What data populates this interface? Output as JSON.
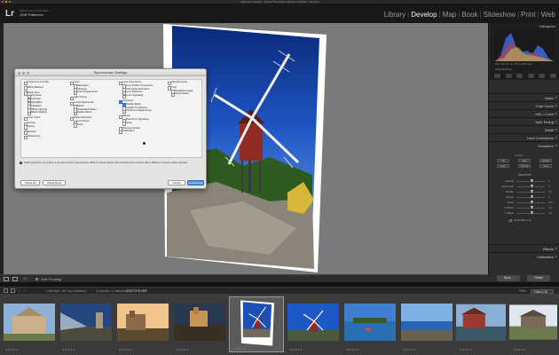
{
  "window": {
    "title": "Lightroom Catalog - Adobe Photoshop Lightroom Classic - Develop"
  },
  "identity": {
    "line1": "Setting up for connection",
    "line2": "JDW Patterson"
  },
  "logo": "Lr",
  "modules": [
    "Library",
    "Develop",
    "Map",
    "Book",
    "Slideshow",
    "Print",
    "Web"
  ],
  "active_module": "Develop",
  "histogram": {
    "label": "Histogram",
    "meta": "ISO 100   23 mm   f/8.0   1/250 sec",
    "original": "Original Photo"
  },
  "panels": {
    "basic": "Basic",
    "tone_curve": "Tone Curve",
    "hsl": "HSL / Color",
    "split_toning": "Split Toning",
    "detail": "Detail",
    "lens_corrections": "Lens Corrections",
    "transform": "Transform",
    "effects": "Effects",
    "calibration": "Calibration"
  },
  "transform_panel": {
    "upright": "Upright",
    "buttons": [
      "Off",
      "Auto",
      "Guided",
      "Level",
      "Vertical",
      "Full"
    ],
    "section": "Transform",
    "sliders": [
      {
        "name": "Vertical",
        "value": "0"
      },
      {
        "name": "Horizontal",
        "value": "0"
      },
      {
        "name": "Rotate",
        "value": "0.0"
      },
      {
        "name": "Aspect",
        "value": "0"
      },
      {
        "name": "Scale",
        "value": "100"
      },
      {
        "name": "X Offset",
        "value": "0.0"
      },
      {
        "name": "Y Offset",
        "value": "0.0"
      }
    ],
    "constrain": "Constrain Crop"
  },
  "sync_buttons": {
    "sync": "Sync...",
    "reset": "Reset"
  },
  "toolbar": {
    "label": "Y|Y",
    "soft_proofing": "Soft Proofing"
  },
  "filmstrip_info": {
    "collection": "Collection : AP Line selection",
    "count": "11 photos / 1 selected",
    "filename": "/DSC7478.NEF",
    "filter_label": "Filter :",
    "filter_value": "Filters Off"
  },
  "dialog": {
    "title": "Synchronise Settings",
    "col1": [
      {
        "label": "Treatment & Profile",
        "checked": false
      },
      {
        "label": "White Balance",
        "checked": false,
        "gap": true
      },
      {
        "label": "Basic Tone",
        "checked": false,
        "gap": true
      },
      {
        "label": "Exposure",
        "checked": false,
        "indent": 1
      },
      {
        "label": "Contrast",
        "checked": false,
        "indent": 1
      },
      {
        "label": "Highlights",
        "checked": false,
        "indent": 1
      },
      {
        "label": "Shadows",
        "checked": false,
        "indent": 1
      },
      {
        "label": "White Clipping",
        "checked": false,
        "indent": 1
      },
      {
        "label": "Black Clipping",
        "checked": false,
        "indent": 1
      },
      {
        "label": "Tone Curve",
        "checked": false,
        "gap": true
      },
      {
        "label": "Texture",
        "checked": false,
        "gap": true
      },
      {
        "label": "Clarity",
        "checked": false
      },
      {
        "label": "Dehaze",
        "checked": false,
        "gap": true
      },
      {
        "label": "Sharpening",
        "checked": false,
        "gap": true
      }
    ],
    "col2": [
      {
        "label": "Color",
        "checked": false
      },
      {
        "label": "Saturation",
        "checked": false,
        "indent": 1
      },
      {
        "label": "Vibrance",
        "checked": false,
        "indent": 1
      },
      {
        "label": "Color Adjustments",
        "checked": false,
        "indent": 1
      },
      {
        "label": "Split Toning",
        "checked": false,
        "gap": true
      },
      {
        "label": "Local Adjustments",
        "checked": false,
        "gap": true
      },
      {
        "label": "Brush",
        "checked": false,
        "indent": 1
      },
      {
        "label": "Graduated Filters",
        "checked": false,
        "indent": 1
      },
      {
        "label": "Radial Filters",
        "checked": false,
        "indent": 1
      },
      {
        "label": "Noise Reduction",
        "checked": false,
        "gap": true
      },
      {
        "label": "Luminance",
        "checked": false,
        "indent": 1
      },
      {
        "label": "Color",
        "checked": false,
        "indent": 1
      }
    ],
    "col3": [
      {
        "label": "Lens Corrections",
        "checked": false
      },
      {
        "label": "Lens Profile Corrections",
        "checked": false,
        "indent": 1
      },
      {
        "label": "Chromatic Aberration",
        "checked": false,
        "indent": 1
      },
      {
        "label": "Lens Distortion",
        "checked": false,
        "indent": 1
      },
      {
        "label": "Lens Vignetting",
        "checked": false,
        "indent": 1
      },
      {
        "label": "Transform",
        "checked": true,
        "gap": true
      },
      {
        "label": "Upright Mode",
        "checked": true,
        "indent": 1
      },
      {
        "label": "Upright Transforms",
        "checked": false,
        "indent": 1
      },
      {
        "label": "Transform Adjustments",
        "checked": false,
        "indent": 1
      },
      {
        "label": "Effects",
        "checked": false,
        "gap": true
      },
      {
        "label": "Post-Crop Vignetting",
        "checked": false,
        "indent": 1
      },
      {
        "label": "Grain",
        "checked": false,
        "indent": 1
      },
      {
        "label": "Process Version",
        "checked": false,
        "gap": true
      },
      {
        "label": "Calibration",
        "checked": false
      }
    ],
    "col4": [
      {
        "label": "Spot Removal",
        "checked": false
      },
      {
        "label": "Crop",
        "checked": false,
        "gap": true
      },
      {
        "label": "Straighten Angle",
        "checked": false,
        "indent": 1
      },
      {
        "label": "Aspect Ratio",
        "checked": false,
        "indent": 1
      }
    ],
    "note": "Settings that do not specify a process version may produce different visual results when transferred to photos with a different process version applied.",
    "buttons": {
      "check_all": "Check All",
      "check_none": "Check None",
      "cancel": "Cancel",
      "synchronise": "Synchronize"
    }
  },
  "colors": {
    "accent": "#4a90e2",
    "workspace": "#7a7a7a",
    "panel": "#2c2c2c"
  }
}
